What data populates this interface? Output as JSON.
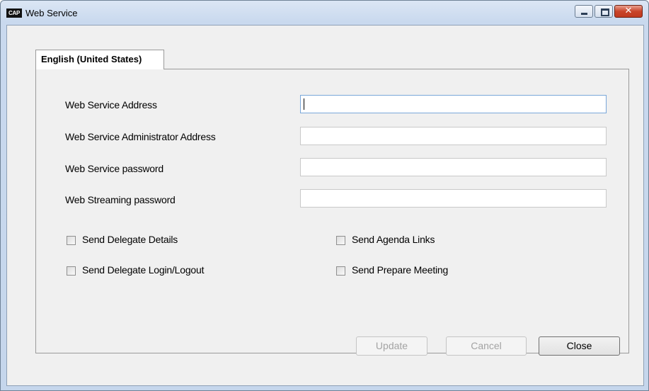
{
  "window": {
    "title": "Web Service",
    "icon_text": "CAP",
    "minimize_glyph": "minimize-icon",
    "maximize_glyph": "maximize-icon",
    "close_glyph": "✕"
  },
  "tab": {
    "label": "English (United States)"
  },
  "fields": [
    {
      "label": "Web Service Address",
      "value": ""
    },
    {
      "label": "Web Service Administrator Address",
      "value": ""
    },
    {
      "label": "Web Service password",
      "value": ""
    },
    {
      "label": "Web Streaming password",
      "value": ""
    }
  ],
  "checkboxes": [
    {
      "label": "Send Delegate Details",
      "checked": false
    },
    {
      "label": "Send Agenda Links",
      "checked": false
    },
    {
      "label": "Send Delegate Login/Logout",
      "checked": false
    },
    {
      "label": "Send Prepare Meeting",
      "checked": false
    }
  ],
  "buttons": {
    "update": "Update",
    "cancel": "Cancel",
    "close": "Close"
  },
  "colors": {
    "frame": "#c5d6ec",
    "close_button": "#c9442a",
    "panel_bg": "#f0f0f0"
  }
}
